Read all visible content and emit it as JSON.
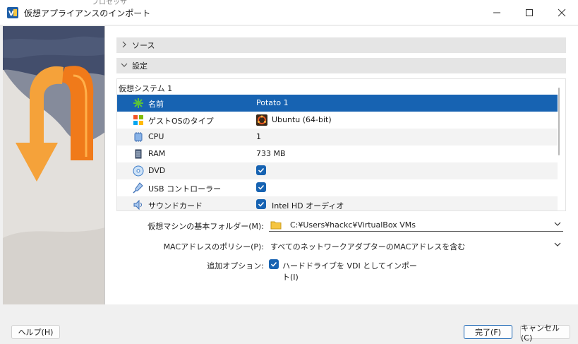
{
  "window": {
    "title": "仮想アプライアンスのインポート",
    "peek_text": "プロセッサ"
  },
  "sections": {
    "source_label": "ソース",
    "settings_label": "設定"
  },
  "system": {
    "group_label": "仮想システム 1",
    "rows": [
      {
        "name": "名前",
        "value": "Potato 1",
        "icon": "green-star-icon"
      },
      {
        "name": "ゲストOSのタイプ",
        "value": "Ubuntu (64-bit)",
        "icon": "os-type-icon"
      },
      {
        "name": "CPU",
        "value": "1",
        "icon": "cpu-icon"
      },
      {
        "name": "RAM",
        "value": "733 MB",
        "icon": "ram-icon"
      },
      {
        "name": "DVD",
        "value": true,
        "icon": "dvd-icon"
      },
      {
        "name": "USB コントローラー",
        "value": true,
        "icon": "usb-icon"
      },
      {
        "name": "サウンドカード",
        "value": "Intel HD オーディオ",
        "icon": "sound-card-icon"
      }
    ]
  },
  "fields": {
    "base_folder_label": "仮想マシンの基本フォルダー(M):",
    "base_folder_value": "C:¥Users¥hackc¥VirtualBox VMs",
    "mac_policy_label": "MACアドレスのポリシー(P):",
    "mac_policy_value": "すべてのネットワークアダプターのMACアドレスを含む",
    "extra_options_label": "追加オプション:",
    "import_vdi_label": "ハードドライブを VDI としてインポート(I)",
    "import_vdi_checked": true
  },
  "buttons": {
    "help": "ヘルプ(H)",
    "finish": "完了(F)",
    "cancel": "キャンセル(C)"
  },
  "colors": {
    "selection": "#1763b2",
    "accent": "#1763b2"
  }
}
